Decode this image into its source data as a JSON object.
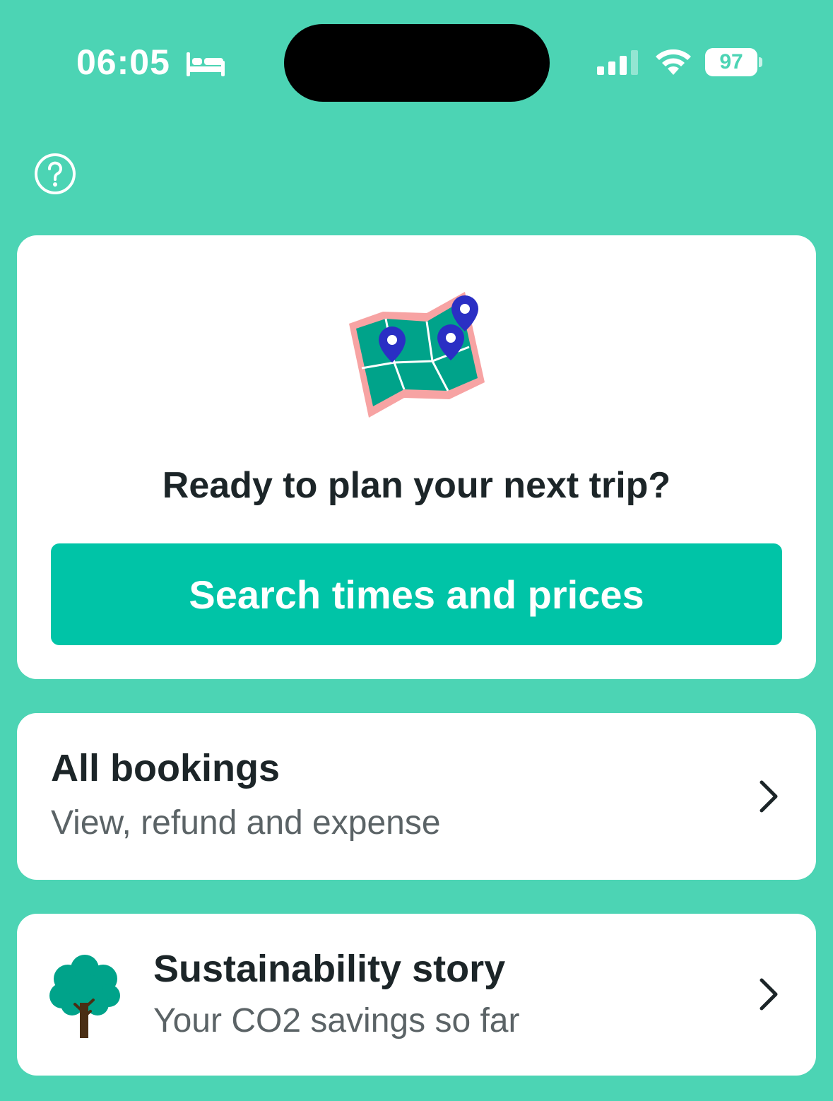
{
  "status_bar": {
    "time": "06:05",
    "battery": "97"
  },
  "plan_card": {
    "heading": "Ready to plan your next trip?",
    "button_label": "Search times and prices"
  },
  "bookings_card": {
    "title": "All bookings",
    "subtitle": "View, refund and expense"
  },
  "sustainability_card": {
    "title": "Sustainability story",
    "subtitle": "Your CO2 savings so far"
  },
  "colors": {
    "background": "#4cd4b4",
    "accent_button": "#00c4a7",
    "text_primary": "#1c2528",
    "text_secondary": "#5b6366",
    "pin_blue": "#2a2fc4",
    "map_green": "#00a38a",
    "map_pink": "#f7a3a3"
  },
  "icons": {
    "status": [
      "bed-icon",
      "signal-icon",
      "wifi-icon",
      "battery-icon"
    ],
    "help": "help-circle-icon",
    "illustration": "map-with-pins-icon",
    "tree": "tree-icon",
    "chevron": "chevron-right-icon"
  }
}
